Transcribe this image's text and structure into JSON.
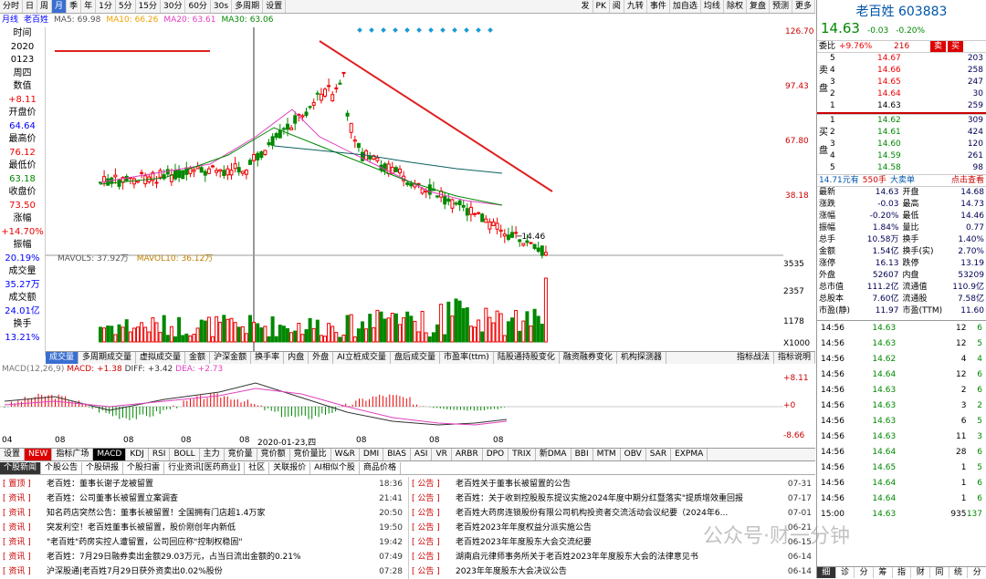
{
  "toolbar": {
    "items": [
      "分时",
      "日",
      "周",
      "月",
      "季",
      "年",
      "1分",
      "5分",
      "15分",
      "30分",
      "60分",
      "30s",
      "多周期",
      "设置"
    ],
    "right": [
      "发",
      "PK",
      "阅",
      "九转",
      "事件",
      "加自选",
      "均线",
      "除权",
      "复盘",
      "预测",
      "更多"
    ]
  },
  "stock_header": {
    "type": "月线",
    "name": "老百姓",
    "ma5": "MA5: 69.98",
    "ma10": "MA10: 66.26",
    "ma20": "MA20: 63.61",
    "ma30": "MA30: 63.06"
  },
  "left_info": [
    {
      "t": "时间",
      "c": ""
    },
    {
      "t": "2020",
      "c": ""
    },
    {
      "t": "0123",
      "c": ""
    },
    {
      "t": "周四",
      "c": ""
    },
    {
      "t": "数值",
      "c": ""
    },
    {
      "t": "+8.11",
      "c": "r"
    },
    {
      "t": "开盘价",
      "c": ""
    },
    {
      "t": "64.64",
      "c": "b"
    },
    {
      "t": "最高价",
      "c": ""
    },
    {
      "t": "76.12",
      "c": "r"
    },
    {
      "t": "最低价",
      "c": ""
    },
    {
      "t": "63.18",
      "c": "g"
    },
    {
      "t": "收盘价",
      "c": ""
    },
    {
      "t": "73.50",
      "c": "r"
    },
    {
      "t": "涨幅",
      "c": ""
    },
    {
      "t": "+14.70%",
      "c": "r"
    },
    {
      "t": "振幅",
      "c": ""
    },
    {
      "t": "20.19%",
      "c": "b"
    },
    {
      "t": "成交量",
      "c": ""
    },
    {
      "t": "35.27万",
      "c": "b"
    },
    {
      "t": "成交额",
      "c": ""
    },
    {
      "t": "24.01亿",
      "c": "b"
    },
    {
      "t": "换手",
      "c": ""
    },
    {
      "t": "13.21%",
      "c": "b"
    }
  ],
  "price_axis": [
    "126.70",
    "97.43",
    "67.80",
    "38.18"
  ],
  "last_price_label": "14.46",
  "vol_header": {
    "a": "MAVOL5: 37.92万",
    "b": "MAVOL10: 36.12万"
  },
  "vol_axis": [
    "3535",
    "2357",
    "1178",
    "X1000"
  ],
  "sub_tabs": [
    "成交量",
    "多周期成交量",
    "虚拟成交量",
    "金额",
    "沪深金额",
    "换手率",
    "内盘",
    "外盘",
    "AI立桩成交量",
    "盘后成交量",
    "市盈率(ttm)",
    "陆股通持股变化",
    "融资融券变化",
    "机构探测器"
  ],
  "sub_tabs_right": [
    "指标战法",
    "指标说明"
  ],
  "macd_header": {
    "a": "MACD(12,26,9)",
    "b": "MACD: +1.38",
    "c": "DIFF: +3.42",
    "d": "DEA: +2.73"
  },
  "macd_axis": [
    "+8.11",
    "+0",
    "-8.66"
  ],
  "date_axis": [
    "04",
    "08",
    "08",
    "08",
    "08",
    "2020-01-23,四",
    "08",
    "08",
    "08"
  ],
  "indicators": [
    "设置",
    "NEW",
    "指标广场",
    "MACD",
    "KDJ",
    "RSI",
    "BOLL",
    "主力",
    "竞价量",
    "竞价额",
    "竞价量比",
    "W&R",
    "DMI",
    "BIAS",
    "ASI",
    "VR",
    "ARBR",
    "DPO",
    "TRIX",
    "新DMA",
    "BBI",
    "MTM",
    "OBV",
    "SAR",
    "EXPMA"
  ],
  "news_tabs": [
    "个股新闻",
    "个股公告",
    "个股研报",
    "个股扫雷",
    "行业资讯[医药商业]",
    "社区",
    "关联报价",
    "AI相似个股",
    "商品价格"
  ],
  "news_left": [
    {
      "tag": "置顶",
      "text": "老百姓：董事长谢子龙被留置",
      "time": "18:36"
    },
    {
      "tag": "资讯",
      "text": "老百姓：公司董事长被留置立案调查",
      "time": "21:41"
    },
    {
      "tag": "资讯",
      "text": "知名药店突然公告：董事长被留置！全国拥有门店超1.4万家",
      "time": "20:50"
    },
    {
      "tag": "资讯",
      "text": "突发利空！老百姓董事长被留置，股价刚创年内新低",
      "time": "19:50"
    },
    {
      "tag": "资讯",
      "text": "\"老百姓\"药房实控人遭留置，公司回应称\"控制权稳固\"",
      "time": "19:42"
    },
    {
      "tag": "资讯",
      "text": "老百姓：7月29日融券卖出金额29.03万元，占当日流出金额的0.21%",
      "time": "07:49"
    },
    {
      "tag": "资讯",
      "text": "沪深股通|老百姓7月29日获外资卖出0.02%股份",
      "time": "07:28"
    }
  ],
  "news_right": [
    {
      "tag": "公告",
      "text": "老百姓关于董事长被留置的公告",
      "time": "07-31"
    },
    {
      "tag": "公告",
      "text": "老百姓：关于收到控股股东提议实施2024年度中期分红暨落实\"提质增效重回报",
      "time": "07-17"
    },
    {
      "tag": "公告",
      "text": "老百姓大药房连锁股份有限公司机构投资者交流活动会议纪要（2024年6...",
      "time": "07-01"
    },
    {
      "tag": "公告",
      "text": "老百姓2023年年度权益分派实施公告",
      "time": "06-21"
    },
    {
      "tag": "公告",
      "text": "老百姓2023年年度股东大会交流纪要",
      "time": "06-15"
    },
    {
      "tag": "公告",
      "text": "湖南启元律师事务所关于老百姓2023年年度股东大会的法律意见书",
      "time": "06-14"
    },
    {
      "tag": "公告",
      "text": "2023年年度股东大会决议公告",
      "time": "06-14"
    }
  ],
  "rp": {
    "name": "老百姓",
    "code": "603883",
    "price": "14.63",
    "chg": "-0.03",
    "pct": "-0.20%",
    "wbl": "委比",
    "wbl_v": "+9.76%",
    "wc": "216",
    "buy": "买",
    "sell": "卖",
    "asks": [
      [
        "5",
        "14.67",
        "203"
      ],
      [
        "4",
        "14.66",
        "258"
      ],
      [
        "3",
        "14.65",
        "247"
      ],
      [
        "2",
        "14.64",
        "30"
      ],
      [
        "1",
        "14.63",
        "259"
      ]
    ],
    "bids": [
      [
        "1",
        "14.62",
        "309"
      ],
      [
        "2",
        "14.61",
        "424"
      ],
      [
        "3",
        "14.60",
        "120"
      ],
      [
        "4",
        "14.59",
        "261"
      ],
      [
        "5",
        "14.58",
        "98"
      ]
    ],
    "sell_label": "卖盘",
    "buy_label": "买盘",
    "big": "14.71元有",
    "big2": "550手",
    "big3": "大卖单",
    "big4": "点击查看",
    "stats": [
      [
        "最新",
        "14.63",
        "开盘",
        "14.68"
      ],
      [
        "涨跌",
        "-0.03",
        "最高",
        "14.73"
      ],
      [
        "涨幅",
        "-0.20%",
        "最低",
        "14.46"
      ],
      [
        "振幅",
        "1.84%",
        "量比",
        "0.77"
      ],
      [
        "总手",
        "10.58万",
        "换手",
        "1.40%"
      ],
      [
        "金额",
        "1.54亿",
        "换手(实)",
        "2.70%"
      ],
      [
        "涨停",
        "16.13",
        "跌停",
        "13.19"
      ],
      [
        "外盘",
        "52607",
        "内盘",
        "53209"
      ],
      [
        "总市值",
        "111.2亿",
        "流通值",
        "110.9亿"
      ],
      [
        "总股本",
        "7.60亿",
        "流通股",
        "7.58亿"
      ],
      [
        "市盈(静)",
        "11.97",
        "市盈(TTM)",
        "11.60"
      ]
    ],
    "ticks": [
      [
        "14:56",
        "14.63",
        "12",
        "6"
      ],
      [
        "14:56",
        "14.63",
        "12",
        "5"
      ],
      [
        "14:56",
        "14.62",
        "4",
        "4"
      ],
      [
        "14:56",
        "14.64",
        "12",
        "6"
      ],
      [
        "14:56",
        "14.63",
        "2",
        "6"
      ],
      [
        "14:56",
        "14.63",
        "3",
        "2"
      ],
      [
        "14:56",
        "14.63",
        "6",
        "5"
      ],
      [
        "14:56",
        "14.63",
        "11",
        "3"
      ],
      [
        "14:56",
        "14.64",
        "28",
        "6"
      ],
      [
        "14:56",
        "14.65",
        "1",
        "5"
      ],
      [
        "14:56",
        "14.64",
        "1",
        "6"
      ],
      [
        "14:56",
        "14.64",
        "1",
        "6"
      ],
      [
        "15:00",
        "14.63",
        "935",
        "137"
      ]
    ],
    "bottom_tabs": [
      "细",
      "诊",
      "分",
      "筹",
      "指",
      "财",
      "同",
      "统",
      "分"
    ]
  },
  "watermark": "公众号·财一分钟"
}
